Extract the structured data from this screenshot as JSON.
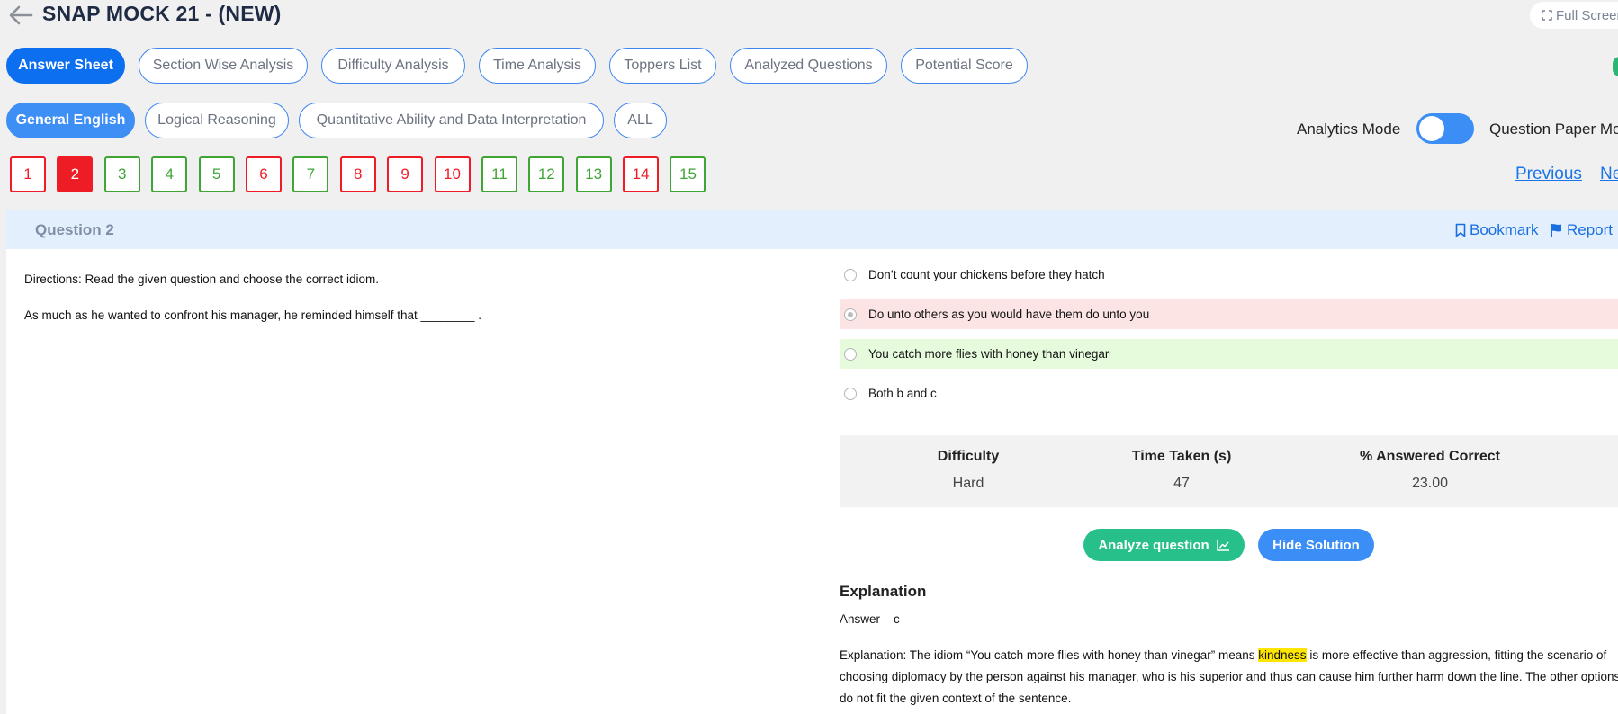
{
  "header": {
    "title": "SNAP MOCK 21 - (NEW)",
    "fullscreen_label": "Full Screen"
  },
  "tabs": [
    {
      "label": "Answer Sheet",
      "active": true
    },
    {
      "label": "Section Wise Analysis"
    },
    {
      "label": "Difficulty Analysis"
    },
    {
      "label": "Time Analysis"
    },
    {
      "label": "Toppers List"
    },
    {
      "label": "Analyzed Questions"
    },
    {
      "label": "Potential Score"
    }
  ],
  "sections": [
    {
      "label": "General English",
      "active": true
    },
    {
      "label": "Logical Reasoning"
    },
    {
      "label": "Quantitative Ability and Data Interpretation"
    },
    {
      "label": "ALL"
    }
  ],
  "mode": {
    "analytics_label": "Analytics Mode",
    "question_paper_label": "Question Paper Mode"
  },
  "question_numbers": [
    {
      "n": "1",
      "status": "incorrect"
    },
    {
      "n": "2",
      "status": "current"
    },
    {
      "n": "3",
      "status": "correct"
    },
    {
      "n": "4",
      "status": "correct"
    },
    {
      "n": "5",
      "status": "correct"
    },
    {
      "n": "6",
      "status": "incorrect"
    },
    {
      "n": "7",
      "status": "correct"
    },
    {
      "n": "8",
      "status": "incorrect"
    },
    {
      "n": "9",
      "status": "incorrect"
    },
    {
      "n": "10",
      "status": "incorrect"
    },
    {
      "n": "11",
      "status": "correct"
    },
    {
      "n": "12",
      "status": "correct"
    },
    {
      "n": "13",
      "status": "correct"
    },
    {
      "n": "14",
      "status": "incorrect"
    },
    {
      "n": "15",
      "status": "correct"
    }
  ],
  "nav": {
    "previous": "Previous",
    "next": "Next"
  },
  "question": {
    "label": "Question 2",
    "bookmark": "Bookmark",
    "report": "Report",
    "directions": "Directions: Read the given question and choose the correct idiom.",
    "text": "As much as he wanted to confront his manager, he reminded himself that ________ .",
    "options": [
      {
        "text": "Don’t count your chickens before they hatch",
        "state": "none"
      },
      {
        "text": "Do unto others as you would have them do unto you",
        "state": "wrong"
      },
      {
        "text": "You catch more flies with honey than vinegar",
        "state": "right"
      },
      {
        "text": "Both b and c",
        "state": "none"
      }
    ]
  },
  "stats": {
    "difficulty_label": "Difficulty",
    "difficulty_value": "Hard",
    "time_label": "Time Taken (s)",
    "time_value": "47",
    "correct_label": "% Answered Correct",
    "correct_value": "23.00"
  },
  "buttons": {
    "analyze": "Analyze question",
    "hide_solution": "Hide Solution"
  },
  "explanation": {
    "title": "Explanation",
    "answer": "Answer – c",
    "text_before": "Explanation: The idiom “You catch more flies with honey than vinegar” means ",
    "highlight": "kindness",
    "text_after": " is more effective than aggression, fitting the scenario of choosing diplomacy by the person against his manager, who is his superior and thus can cause him further harm down the line. The other options do not fit the given context of the sentence."
  },
  "colors": {
    "primary": "#0b6ff0",
    "correct": "#3fa535",
    "incorrect": "#ee1c25",
    "analyze_green": "#27bf8a"
  }
}
